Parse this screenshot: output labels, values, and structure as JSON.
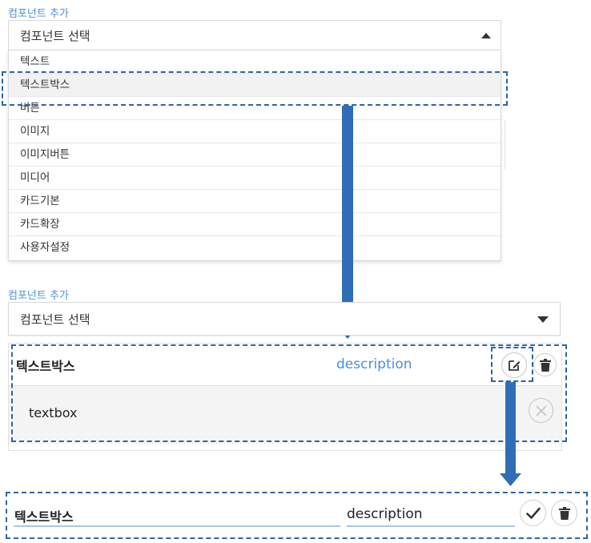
{
  "top": {
    "label": "컴포넌트 추가",
    "select_placeholder": "컴포넌트 선택",
    "options": [
      "텍스트",
      "텍스트박스",
      "버튼",
      "이미지",
      "이미지버튼",
      "미디어",
      "카드기본",
      "카드확장",
      "사용자설정"
    ]
  },
  "middle": {
    "label": "컴포넌트 추가",
    "select_placeholder": "컴포넌트 선택",
    "item": {
      "name": "텍스트박스",
      "description": "description",
      "body_value": "textbox"
    }
  },
  "bottom": {
    "name_value": "텍스트박스",
    "description_value": "description"
  },
  "colors": {
    "accent": "#4a90d9",
    "annotation": "#2f6eb7"
  },
  "icons": [
    "caret-up-icon",
    "caret-down-icon",
    "edit-icon",
    "trash-icon",
    "close-circle-icon",
    "check-icon"
  ]
}
